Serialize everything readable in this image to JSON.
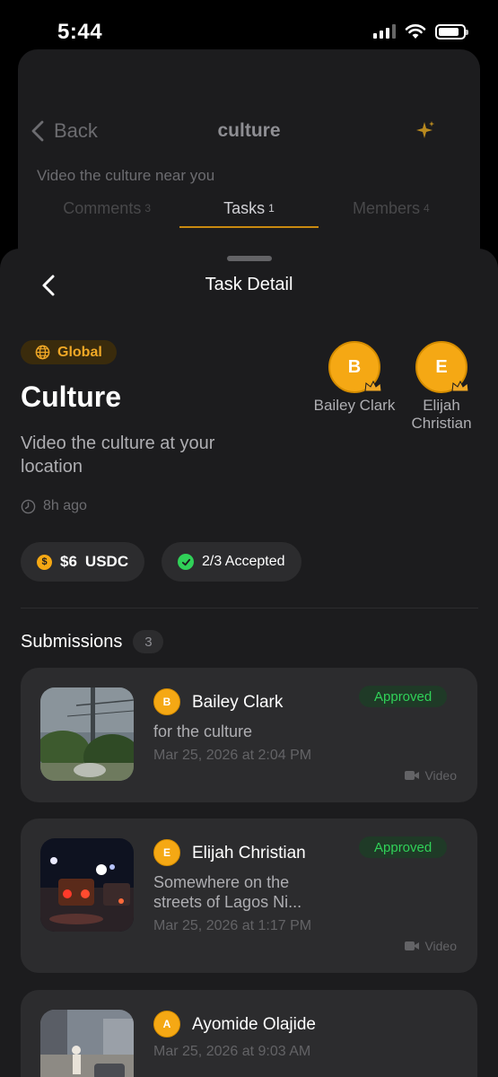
{
  "status_bar": {
    "time": "5:44"
  },
  "background_screen": {
    "back_label": "Back",
    "title": "culture",
    "description": "Video the culture near you",
    "tabs": [
      {
        "label": "Comments",
        "count": "3",
        "active": false
      },
      {
        "label": "Tasks",
        "count": "1",
        "active": true
      },
      {
        "label": "Members",
        "count": "4",
        "active": false
      }
    ]
  },
  "sheet": {
    "title": "Task Detail",
    "scope": "Global",
    "task_title": "Culture",
    "task_description": "Video the culture at your location",
    "posted": "8h ago",
    "reward": {
      "amount": "$6",
      "currency": "USDC"
    },
    "accepted": "2/3 Accepted",
    "members": [
      {
        "initial": "B",
        "name": "Bailey Clark"
      },
      {
        "initial": "E",
        "name": "Elijah Christian"
      }
    ],
    "submissions_label": "Submissions",
    "submissions_count": "3",
    "submissions": [
      {
        "initial": "B",
        "name": "Bailey Clark",
        "caption": "for the culture",
        "date": "Mar 25, 2026 at 2:04 PM",
        "status": "Approved",
        "media": "Video"
      },
      {
        "initial": "E",
        "name": "Elijah Christian",
        "caption": "Somewhere on the streets of Lagos Ni...",
        "date": "Mar 25, 2026 at 1:17 PM",
        "status": "Approved",
        "media": "Video"
      },
      {
        "initial": "A",
        "name": "Ayomide Olajide",
        "date": "Mar 25, 2026 at 9:03 AM"
      }
    ]
  },
  "colors": {
    "accent": "#f5a814",
    "approved": "#30d158",
    "surface": "#2c2c2e",
    "sheet": "#1c1c1e"
  }
}
